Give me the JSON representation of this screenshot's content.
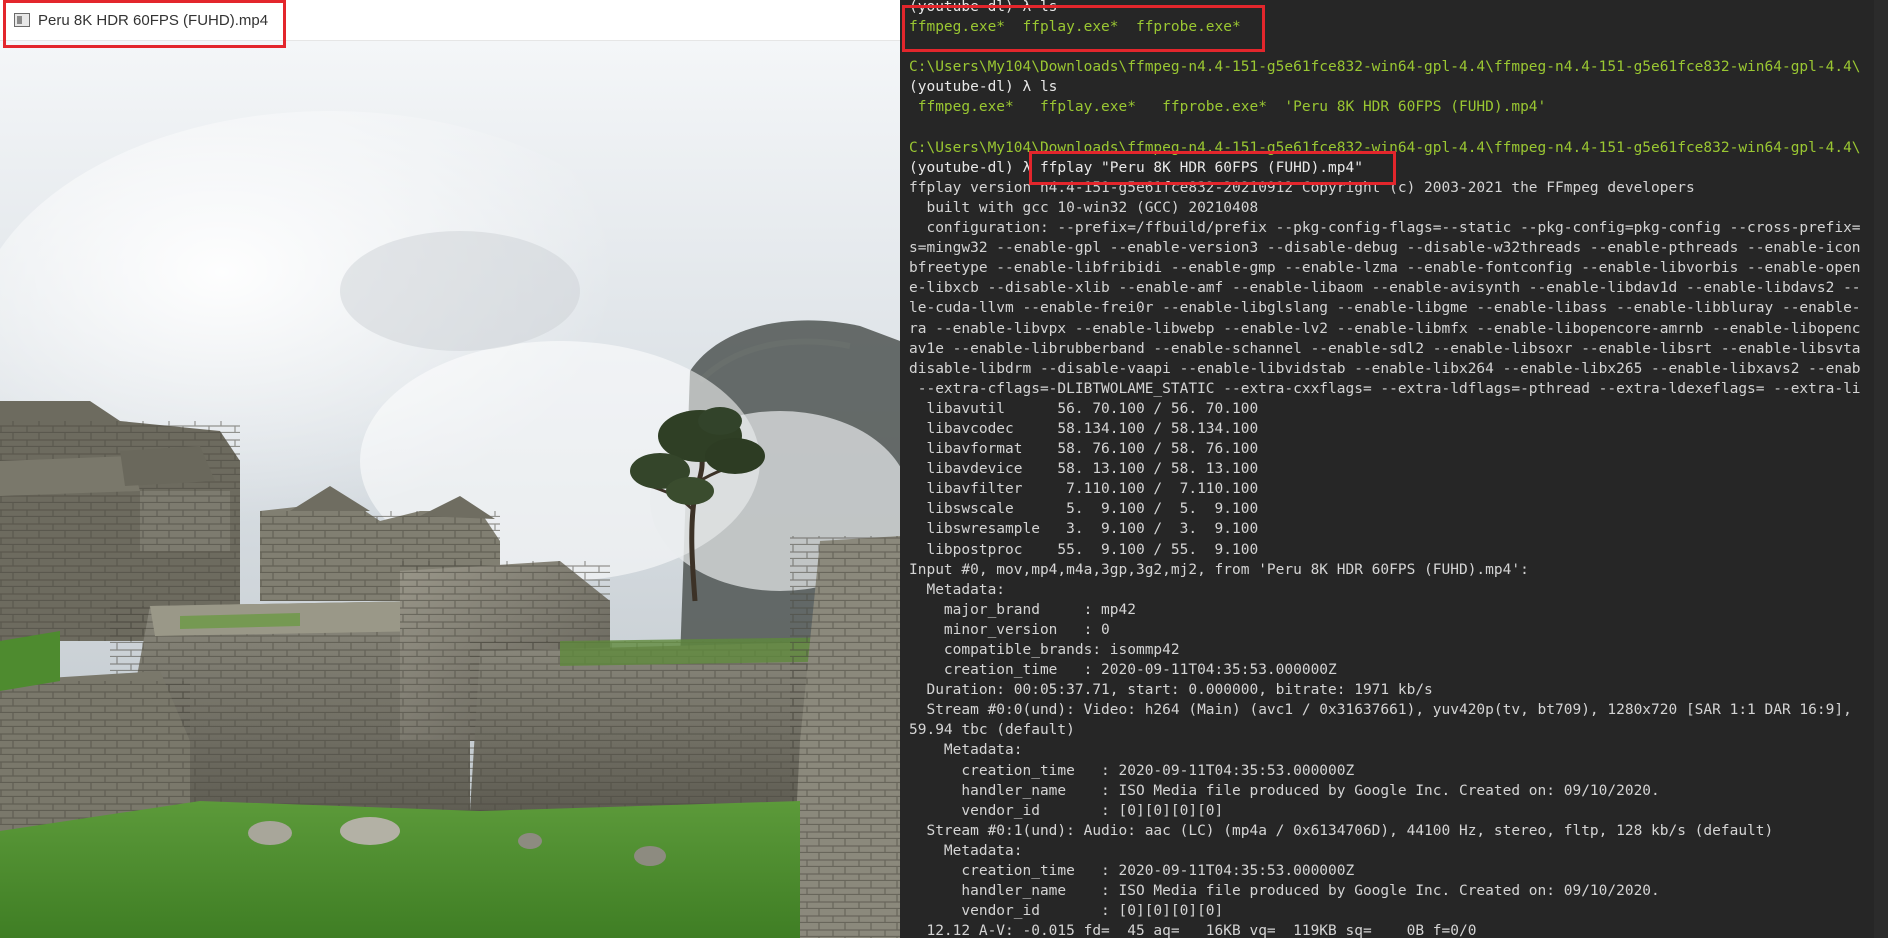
{
  "player": {
    "window_title": "Peru 8K HDR 60FPS (FUHD).mp4",
    "app_icon": "ffplay-window-icon",
    "scene": "Machu Picchu stone ruins with clouds and a lone tree"
  },
  "terminal": {
    "lines": [
      {
        "cls": "white",
        "text": "(youtube-dl) λ ls"
      },
      {
        "cls": "files",
        "text": "ffmpeg.exe*  ffplay.exe*  ffprobe.exe*"
      },
      {
        "cls": "",
        "text": ""
      },
      {
        "cls": "green",
        "text": "C:\\Users\\My104\\Downloads\\ffmpeg-n4.4-151-g5e61fce832-win64-gpl-4.4\\ffmpeg-n4.4-151-g5e61fce832-win64-gpl-4.4\\"
      },
      {
        "cls": "white",
        "text": "(youtube-dl) λ ls"
      },
      {
        "cls": "files",
        "text": " ffmpeg.exe*   ffplay.exe*   ffprobe.exe*  'Peru 8K HDR 60FPS (FUHD).mp4'"
      },
      {
        "cls": "",
        "text": ""
      },
      {
        "cls": "green",
        "text": "C:\\Users\\My104\\Downloads\\ffmpeg-n4.4-151-g5e61fce832-win64-gpl-4.4\\ffmpeg-n4.4-151-g5e61fce832-win64-gpl-4.4\\"
      },
      {
        "cls": "white",
        "text": "(youtube-dl) λ ffplay \"Peru 8K HDR 60FPS (FUHD).mp4\""
      },
      {
        "cls": "",
        "text": "ffplay version n4.4-151-g5e61fce832-20210912 Copyright (c) 2003-2021 the FFmpeg developers"
      },
      {
        "cls": "",
        "text": "  built with gcc 10-win32 (GCC) 20210408"
      },
      {
        "cls": "",
        "text": "  configuration: --prefix=/ffbuild/prefix --pkg-config-flags=--static --pkg-config=pkg-config --cross-prefix="
      },
      {
        "cls": "",
        "text": "s=mingw32 --enable-gpl --enable-version3 --disable-debug --disable-w32threads --enable-pthreads --enable-icon"
      },
      {
        "cls": "",
        "text": "bfreetype --enable-libfribidi --enable-gmp --enable-lzma --enable-fontconfig --enable-libvorbis --enable-open"
      },
      {
        "cls": "",
        "text": "e-libxcb --disable-xlib --enable-amf --enable-libaom --enable-avisynth --enable-libdav1d --enable-libdavs2 --"
      },
      {
        "cls": "",
        "text": "le-cuda-llvm --enable-frei0r --enable-libglslang --enable-libgme --enable-libass --enable-libbluray --enable-"
      },
      {
        "cls": "",
        "text": "ra --enable-libvpx --enable-libwebp --enable-lv2 --enable-libmfx --enable-libopencore-amrnb --enable-libopenc"
      },
      {
        "cls": "",
        "text": "av1e --enable-librubberband --enable-schannel --enable-sdl2 --enable-libsoxr --enable-libsrt --enable-libsvta"
      },
      {
        "cls": "",
        "text": "disable-libdrm --disable-vaapi --enable-libvidstab --enable-libx264 --enable-libx265 --enable-libxavs2 --enab"
      },
      {
        "cls": "",
        "text": " --extra-cflags=-DLIBTWOLAME_STATIC --extra-cxxflags= --extra-ldflags=-pthread --extra-ldexeflags= --extra-li"
      },
      {
        "cls": "",
        "text": "  libavutil      56. 70.100 / 56. 70.100"
      },
      {
        "cls": "",
        "text": "  libavcodec     58.134.100 / 58.134.100"
      },
      {
        "cls": "",
        "text": "  libavformat    58. 76.100 / 58. 76.100"
      },
      {
        "cls": "",
        "text": "  libavdevice    58. 13.100 / 58. 13.100"
      },
      {
        "cls": "",
        "text": "  libavfilter     7.110.100 /  7.110.100"
      },
      {
        "cls": "",
        "text": "  libswscale      5.  9.100 /  5.  9.100"
      },
      {
        "cls": "",
        "text": "  libswresample   3.  9.100 /  3.  9.100"
      },
      {
        "cls": "",
        "text": "  libpostproc    55.  9.100 / 55.  9.100"
      },
      {
        "cls": "",
        "text": "Input #0, mov,mp4,m4a,3gp,3g2,mj2, from 'Peru 8K HDR 60FPS (FUHD).mp4':"
      },
      {
        "cls": "",
        "text": "  Metadata:"
      },
      {
        "cls": "",
        "text": "    major_brand     : mp42"
      },
      {
        "cls": "",
        "text": "    minor_version   : 0"
      },
      {
        "cls": "",
        "text": "    compatible_brands: isommp42"
      },
      {
        "cls": "",
        "text": "    creation_time   : 2020-09-11T04:35:53.000000Z"
      },
      {
        "cls": "",
        "text": "  Duration: 00:05:37.71, start: 0.000000, bitrate: 1971 kb/s"
      },
      {
        "cls": "",
        "text": "  Stream #0:0(und): Video: h264 (Main) (avc1 / 0x31637661), yuv420p(tv, bt709), 1280x720 [SAR 1:1 DAR 16:9],"
      },
      {
        "cls": "",
        "text": "59.94 tbc (default)"
      },
      {
        "cls": "",
        "text": "    Metadata:"
      },
      {
        "cls": "",
        "text": "      creation_time   : 2020-09-11T04:35:53.000000Z"
      },
      {
        "cls": "",
        "text": "      handler_name    : ISO Media file produced by Google Inc. Created on: 09/10/2020."
      },
      {
        "cls": "",
        "text": "      vendor_id       : [0][0][0][0]"
      },
      {
        "cls": "",
        "text": "  Stream #0:1(und): Audio: aac (LC) (mp4a / 0x6134706D), 44100 Hz, stereo, fltp, 128 kb/s (default)"
      },
      {
        "cls": "",
        "text": "    Metadata:"
      },
      {
        "cls": "",
        "text": "      creation_time   : 2020-09-11T04:35:53.000000Z"
      },
      {
        "cls": "",
        "text": "      handler_name    : ISO Media file produced by Google Inc. Created on: 09/10/2020."
      },
      {
        "cls": "",
        "text": "      vendor_id       : [0][0][0][0]"
      },
      {
        "cls": "",
        "text": "  12.12 A-V: -0.015 fd=  45 aq=   16KB vq=  119KB sq=    0B f=0/0"
      }
    ]
  },
  "colors": {
    "highlight": "#e3262c",
    "terminal_bg": "#262626",
    "path_green": "#9ac732"
  }
}
